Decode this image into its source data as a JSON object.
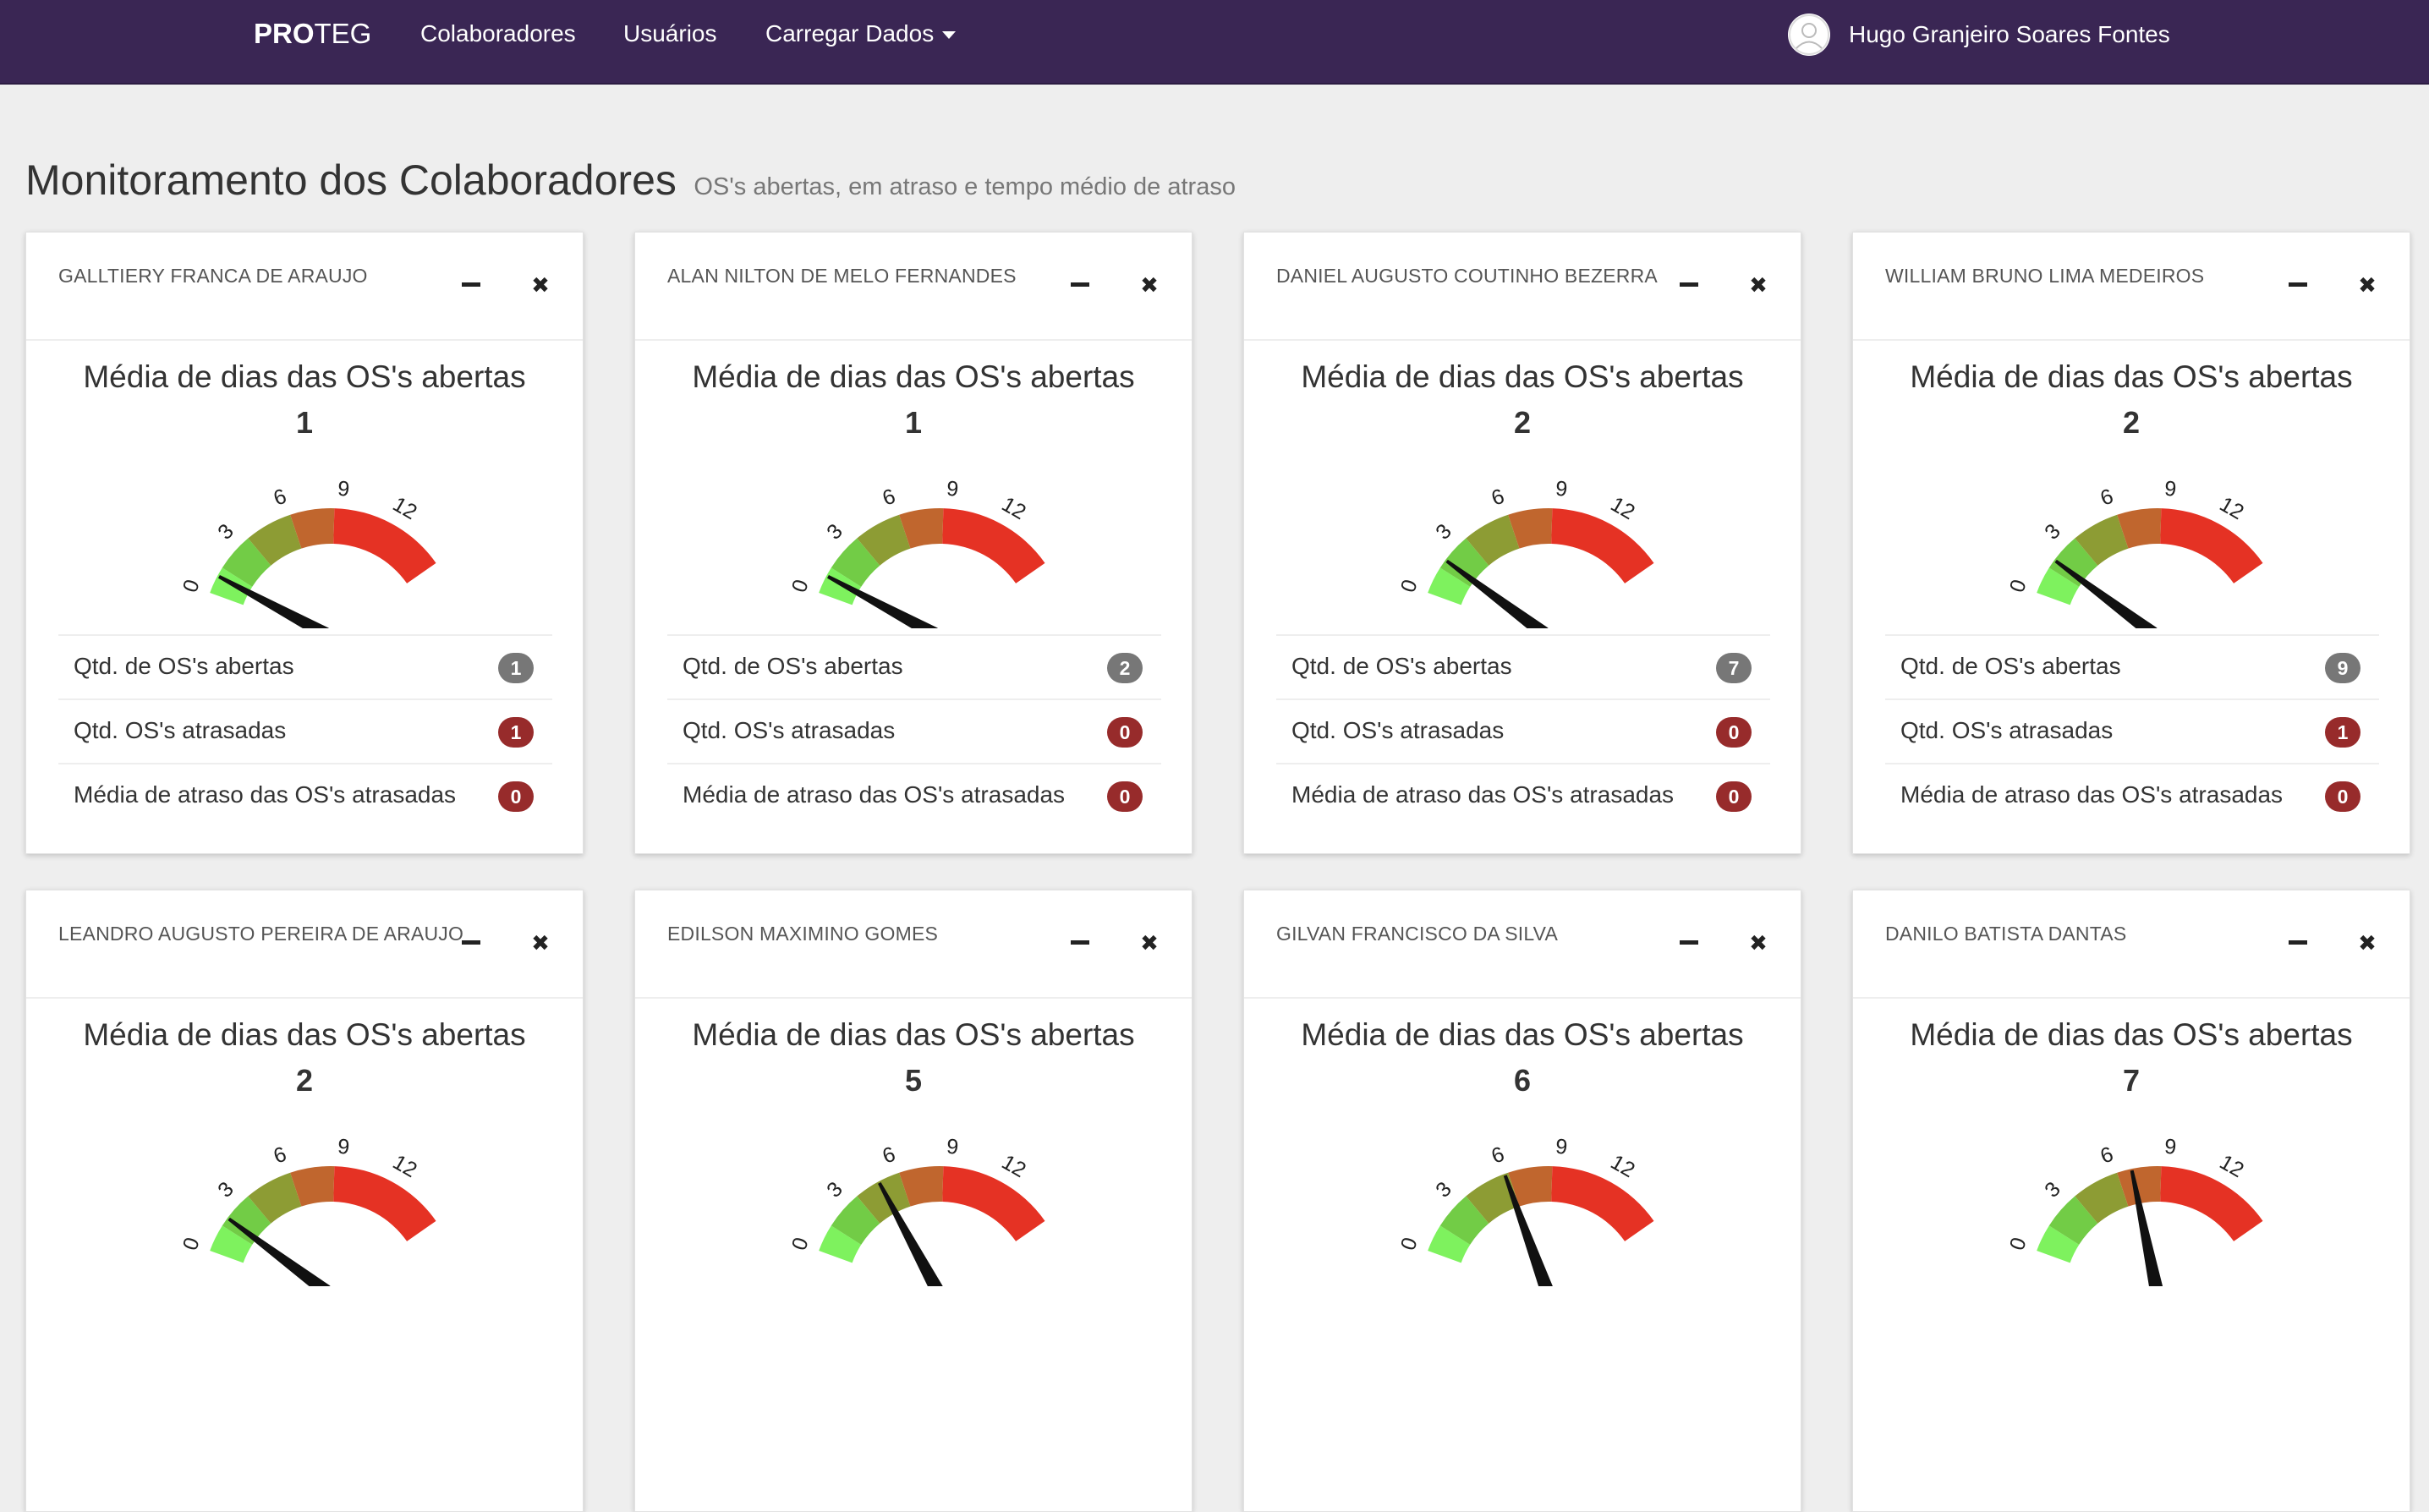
{
  "nav": {
    "brand_bold": "PRO",
    "brand_light": "TEG",
    "links": [
      "Colaboradores",
      "Usuários",
      "Carregar Dados"
    ],
    "user_name": "Hugo Granjeiro Soares Fontes"
  },
  "page": {
    "title": "Monitoramento dos Colaboradores",
    "subtitle": "OS's abertas, em atraso e tempo médio de atraso"
  },
  "card_common": {
    "gauge_title": "Média de dias das OS's abertas",
    "stat_labels": [
      "Qtd. de OS's abertas",
      "Qtd. OS's atrasadas",
      "Média de atraso das OS's atrasadas"
    ],
    "gauge_ticks": [
      "0",
      "3",
      "6",
      "9",
      "12"
    ],
    "gauge_colors": [
      "#7ef25e",
      "#72cc46",
      "#8d9c34",
      "#c0662e",
      "#e53224"
    ]
  },
  "cards": [
    {
      "name": "GALLTIERY FRANCA DE ARAUJO",
      "avg_days": "1",
      "open": "1",
      "late": "1",
      "avg_late": "0"
    },
    {
      "name": "ALAN NILTON DE MELO FERNANDES",
      "avg_days": "1",
      "open": "2",
      "late": "0",
      "avg_late": "0"
    },
    {
      "name": "DANIEL AUGUSTO COUTINHO BEZERRA",
      "avg_days": "2",
      "open": "7",
      "late": "0",
      "avg_late": "0"
    },
    {
      "name": "WILLIAM BRUNO LIMA MEDEIROS",
      "avg_days": "2",
      "open": "9",
      "late": "1",
      "avg_late": "0"
    },
    {
      "name": "LEANDRO AUGUSTO PEREIRA DE ARAUJO",
      "avg_days": "2"
    },
    {
      "name": "EDILSON MAXIMINO GOMES",
      "avg_days": "5"
    },
    {
      "name": "GILVAN FRANCISCO DA SILVA",
      "avg_days": "6"
    },
    {
      "name": "DANILO BATISTA DANTAS",
      "avg_days": "7"
    }
  ]
}
